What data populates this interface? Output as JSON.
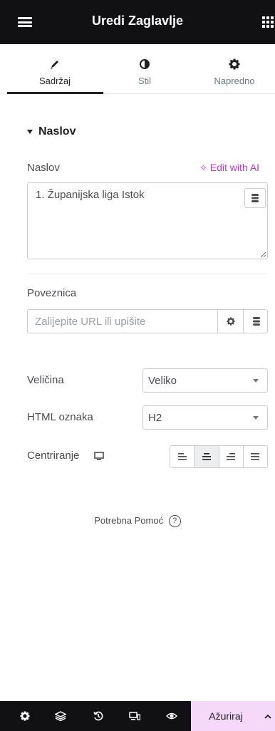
{
  "header": {
    "title": "Uredi Zaglavlje"
  },
  "tabs": [
    {
      "label": "Sadržaj",
      "icon": "pencil-icon",
      "active": true
    },
    {
      "label": "Stil",
      "icon": "half-circle-icon",
      "active": false
    },
    {
      "label": "Napredno",
      "icon": "gear-icon",
      "active": false
    }
  ],
  "section": {
    "title": "Naslov"
  },
  "fields": {
    "title_label": "Naslov",
    "ai_link": "Edit with AI",
    "title_value": "1. Županijska liga Istok",
    "link_label": "Poveznica",
    "link_placeholder": "Zalijepite URL ili upišite",
    "size_label": "Veličina",
    "size_value": "Veliko",
    "html_tag_label": "HTML oznaka",
    "html_tag_value": "H2",
    "align_label": "Centriranje",
    "align_options": [
      "left",
      "center",
      "right",
      "justify"
    ],
    "align_selected": "center"
  },
  "help": {
    "text": "Potrebna Pomoć",
    "icon": "question-icon"
  },
  "footer": {
    "icons": [
      "gear-icon",
      "layers-icon",
      "history-icon",
      "responsive-icon",
      "eye-icon"
    ],
    "update_label": "Ažuriraj"
  },
  "colors": {
    "header_bg": "#111113",
    "accent": "#c036d4",
    "update_bg": "#f5d8fa"
  }
}
